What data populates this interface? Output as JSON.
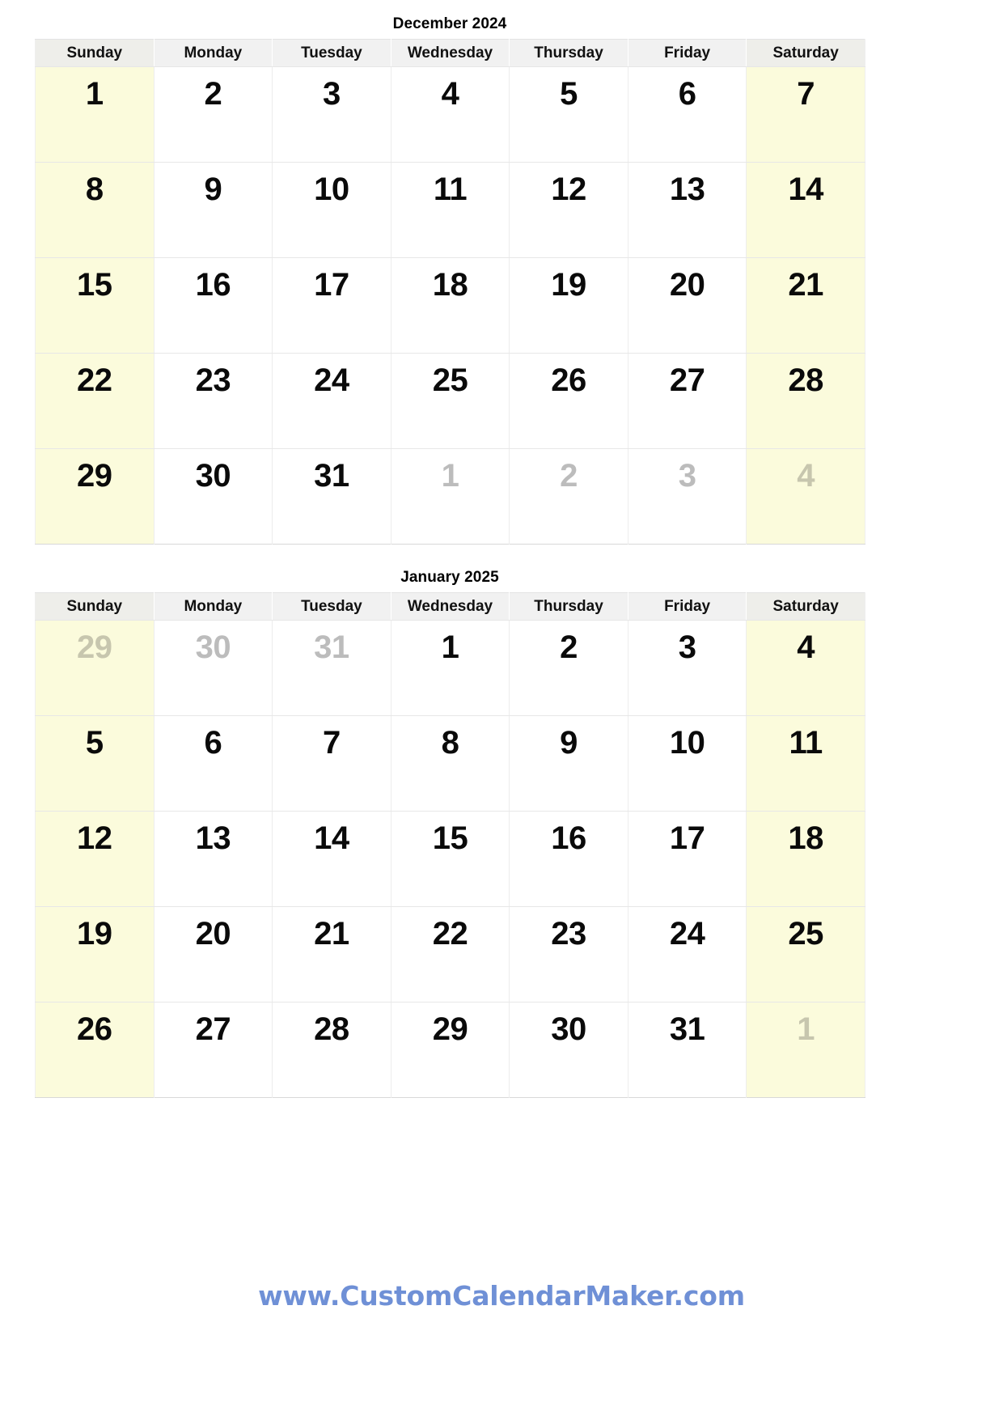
{
  "page": {
    "background_color": "#ffffff",
    "weekend_cell_color": "#fbfbdc",
    "header_cell_color": "#f1f1f1",
    "outside_day_color": "#bcbcbc",
    "footer_link_color": "#6f90d6"
  },
  "weekdays": [
    "Sunday",
    "Monday",
    "Tuesday",
    "Wednesday",
    "Thursday",
    "Friday",
    "Saturday"
  ],
  "months": [
    {
      "title": "December 2024",
      "weeks": [
        [
          {
            "day": "1",
            "outside": false,
            "weekend": true
          },
          {
            "day": "2",
            "outside": false,
            "weekend": false
          },
          {
            "day": "3",
            "outside": false,
            "weekend": false
          },
          {
            "day": "4",
            "outside": false,
            "weekend": false
          },
          {
            "day": "5",
            "outside": false,
            "weekend": false
          },
          {
            "day": "6",
            "outside": false,
            "weekend": false
          },
          {
            "day": "7",
            "outside": false,
            "weekend": true
          }
        ],
        [
          {
            "day": "8",
            "outside": false,
            "weekend": true
          },
          {
            "day": "9",
            "outside": false,
            "weekend": false
          },
          {
            "day": "10",
            "outside": false,
            "weekend": false
          },
          {
            "day": "11",
            "outside": false,
            "weekend": false
          },
          {
            "day": "12",
            "outside": false,
            "weekend": false
          },
          {
            "day": "13",
            "outside": false,
            "weekend": false
          },
          {
            "day": "14",
            "outside": false,
            "weekend": true
          }
        ],
        [
          {
            "day": "15",
            "outside": false,
            "weekend": true
          },
          {
            "day": "16",
            "outside": false,
            "weekend": false
          },
          {
            "day": "17",
            "outside": false,
            "weekend": false
          },
          {
            "day": "18",
            "outside": false,
            "weekend": false
          },
          {
            "day": "19",
            "outside": false,
            "weekend": false
          },
          {
            "day": "20",
            "outside": false,
            "weekend": false
          },
          {
            "day": "21",
            "outside": false,
            "weekend": true
          }
        ],
        [
          {
            "day": "22",
            "outside": false,
            "weekend": true
          },
          {
            "day": "23",
            "outside": false,
            "weekend": false
          },
          {
            "day": "24",
            "outside": false,
            "weekend": false
          },
          {
            "day": "25",
            "outside": false,
            "weekend": false
          },
          {
            "day": "26",
            "outside": false,
            "weekend": false
          },
          {
            "day": "27",
            "outside": false,
            "weekend": false
          },
          {
            "day": "28",
            "outside": false,
            "weekend": true
          }
        ],
        [
          {
            "day": "29",
            "outside": false,
            "weekend": true
          },
          {
            "day": "30",
            "outside": false,
            "weekend": false
          },
          {
            "day": "31",
            "outside": false,
            "weekend": false
          },
          {
            "day": "1",
            "outside": true,
            "weekend": false
          },
          {
            "day": "2",
            "outside": true,
            "weekend": false
          },
          {
            "day": "3",
            "outside": true,
            "weekend": false
          },
          {
            "day": "4",
            "outside": true,
            "weekend": true
          }
        ]
      ]
    },
    {
      "title": "January 2025",
      "weeks": [
        [
          {
            "day": "29",
            "outside": true,
            "weekend": true
          },
          {
            "day": "30",
            "outside": true,
            "weekend": false
          },
          {
            "day": "31",
            "outside": true,
            "weekend": false
          },
          {
            "day": "1",
            "outside": false,
            "weekend": false
          },
          {
            "day": "2",
            "outside": false,
            "weekend": false
          },
          {
            "day": "3",
            "outside": false,
            "weekend": false
          },
          {
            "day": "4",
            "outside": false,
            "weekend": true
          }
        ],
        [
          {
            "day": "5",
            "outside": false,
            "weekend": true
          },
          {
            "day": "6",
            "outside": false,
            "weekend": false
          },
          {
            "day": "7",
            "outside": false,
            "weekend": false
          },
          {
            "day": "8",
            "outside": false,
            "weekend": false
          },
          {
            "day": "9",
            "outside": false,
            "weekend": false
          },
          {
            "day": "10",
            "outside": false,
            "weekend": false
          },
          {
            "day": "11",
            "outside": false,
            "weekend": true
          }
        ],
        [
          {
            "day": "12",
            "outside": false,
            "weekend": true
          },
          {
            "day": "13",
            "outside": false,
            "weekend": false
          },
          {
            "day": "14",
            "outside": false,
            "weekend": false
          },
          {
            "day": "15",
            "outside": false,
            "weekend": false
          },
          {
            "day": "16",
            "outside": false,
            "weekend": false
          },
          {
            "day": "17",
            "outside": false,
            "weekend": false
          },
          {
            "day": "18",
            "outside": false,
            "weekend": true
          }
        ],
        [
          {
            "day": "19",
            "outside": false,
            "weekend": true
          },
          {
            "day": "20",
            "outside": false,
            "weekend": false
          },
          {
            "day": "21",
            "outside": false,
            "weekend": false
          },
          {
            "day": "22",
            "outside": false,
            "weekend": false
          },
          {
            "day": "23",
            "outside": false,
            "weekend": false
          },
          {
            "day": "24",
            "outside": false,
            "weekend": false
          },
          {
            "day": "25",
            "outside": false,
            "weekend": true
          }
        ],
        [
          {
            "day": "26",
            "outside": false,
            "weekend": true
          },
          {
            "day": "27",
            "outside": false,
            "weekend": false
          },
          {
            "day": "28",
            "outside": false,
            "weekend": false
          },
          {
            "day": "29",
            "outside": false,
            "weekend": false
          },
          {
            "day": "30",
            "outside": false,
            "weekend": false
          },
          {
            "day": "31",
            "outside": false,
            "weekend": false
          },
          {
            "day": "1",
            "outside": true,
            "weekend": true
          }
        ]
      ]
    }
  ],
  "footer": {
    "url_text": "www.CustomCalendarMaker.com"
  }
}
